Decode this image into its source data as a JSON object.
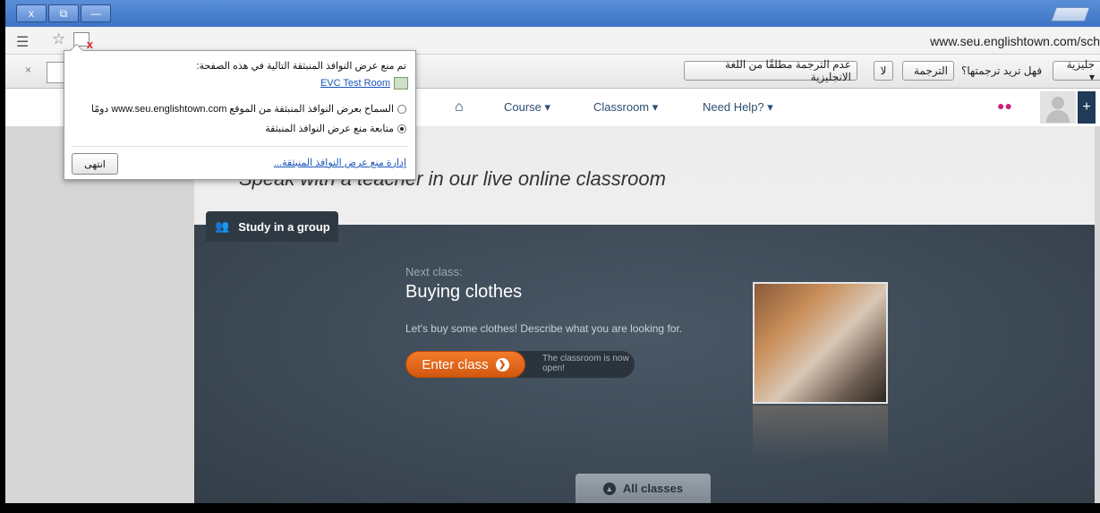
{
  "window": {
    "close": "x",
    "restore": "⧉",
    "minimize": "—"
  },
  "toolbar": {
    "url": "www.seu.englishtown.com/sch"
  },
  "translate_bar": {
    "close": "×",
    "lang_select": "جليزية ▾",
    "question": "فهل تريد ترجمتها؟",
    "translate_button": "الترجمة",
    "no_button": "لا",
    "never_button": "عدم الترجمة مطلقًا من اللغة الانجليزية"
  },
  "popup": {
    "heading": "تم منع عرض النوافذ المنبثقة التالية في هذه الصفحة:",
    "link": "EVC Test Room",
    "option_allow": "السماح بعرض النوافذ المنبثقة من الموقع www.seu.englishtown.com دومًا",
    "option_block": "متابعة منع عرض النوافذ المنبثقة",
    "manage": "إدارة منع عرض النوافذ المنبثقة...",
    "done": "انتهى"
  },
  "nav": {
    "course": "Course ▾",
    "classroom": "Classroom ▾",
    "help": "Need Help? ▾",
    "plus": "+"
  },
  "main": {
    "hero_title": "Speak with a teacher in our live online classroom",
    "study_tab": "Study in a group",
    "next_label": "Next class:",
    "class_title": "Buying clothes",
    "class_desc": "Let's buy some clothes! Describe what you are looking for.",
    "enter_button": "Enter class",
    "enter_note": "The classroom is now open!",
    "all_classes": "All classes"
  }
}
